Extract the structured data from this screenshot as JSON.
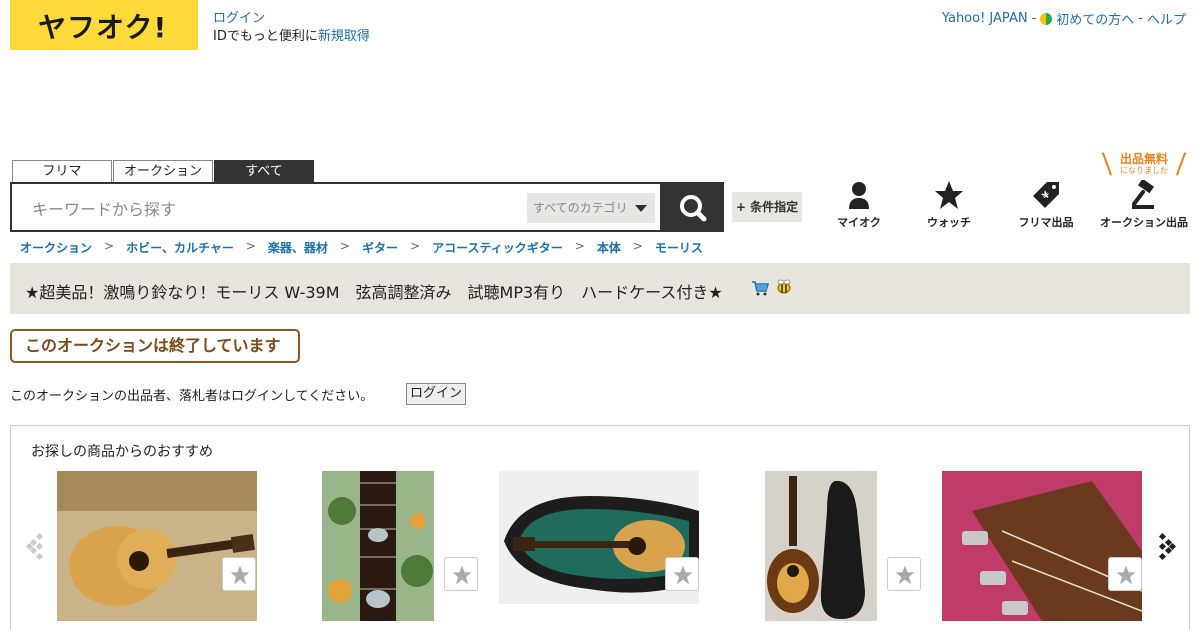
{
  "header": {
    "logo_text": "ヤフオク!",
    "login_label": "ログイン",
    "login_sub_text": "IDでもっと便利に",
    "register_label": "新規取得",
    "top_links": [
      "Yahoo! JAPAN",
      "初めての方へ",
      "ヘルプ"
    ],
    "separator": "-"
  },
  "search": {
    "tabs": [
      "フリマ",
      "オークション",
      "すべて"
    ],
    "active_tab": "すべて",
    "placeholder": "キーワードから探す",
    "category_select": "すべてのカテゴリ",
    "advanced_label": "+ 条件指定",
    "free_badge_big": "出品無料",
    "free_badge_small": "になりました"
  },
  "nav_icons": [
    {
      "label": "マイオク",
      "icon": "person-icon"
    },
    {
      "label": "ウォッチ",
      "icon": "star-icon"
    },
    {
      "label": "フリマ出品",
      "icon": "price-tag-icon"
    },
    {
      "label": "オークション出品",
      "icon": "gavel-icon"
    }
  ],
  "breadcrumb": [
    "オークション",
    "ホビー、カルチャー",
    "楽器、器材",
    "ギター",
    "アコースティックギター",
    "本体",
    "モーリス"
  ],
  "listing": {
    "title": "★超美品！激鳴り鈴なり！モーリス W-39M　弦高調整済み　試聴MP3有り　ハードケース付き★",
    "status": "このオークションは終了しています",
    "notice": "このオークションの出品者、落札者はログインしてください。",
    "login_button": "ログイン"
  },
  "recommendations": {
    "title": "お探しの商品からのおすすめ",
    "items": [
      {
        "image": "acoustic-guitar-on-floor"
      },
      {
        "image": "guitar-fretboard-inlay"
      },
      {
        "image": "guitar-in-green-case"
      },
      {
        "image": "guitar-with-gig-bag"
      },
      {
        "image": "morris-headstock"
      }
    ]
  },
  "colors": {
    "brand_yellow": "#ffda3a",
    "link_blue": "#1e6ea7",
    "title_bar_bg": "#e6e4dc",
    "ended_brown": "#8a5a2a",
    "free_orange": "#e8821e"
  }
}
